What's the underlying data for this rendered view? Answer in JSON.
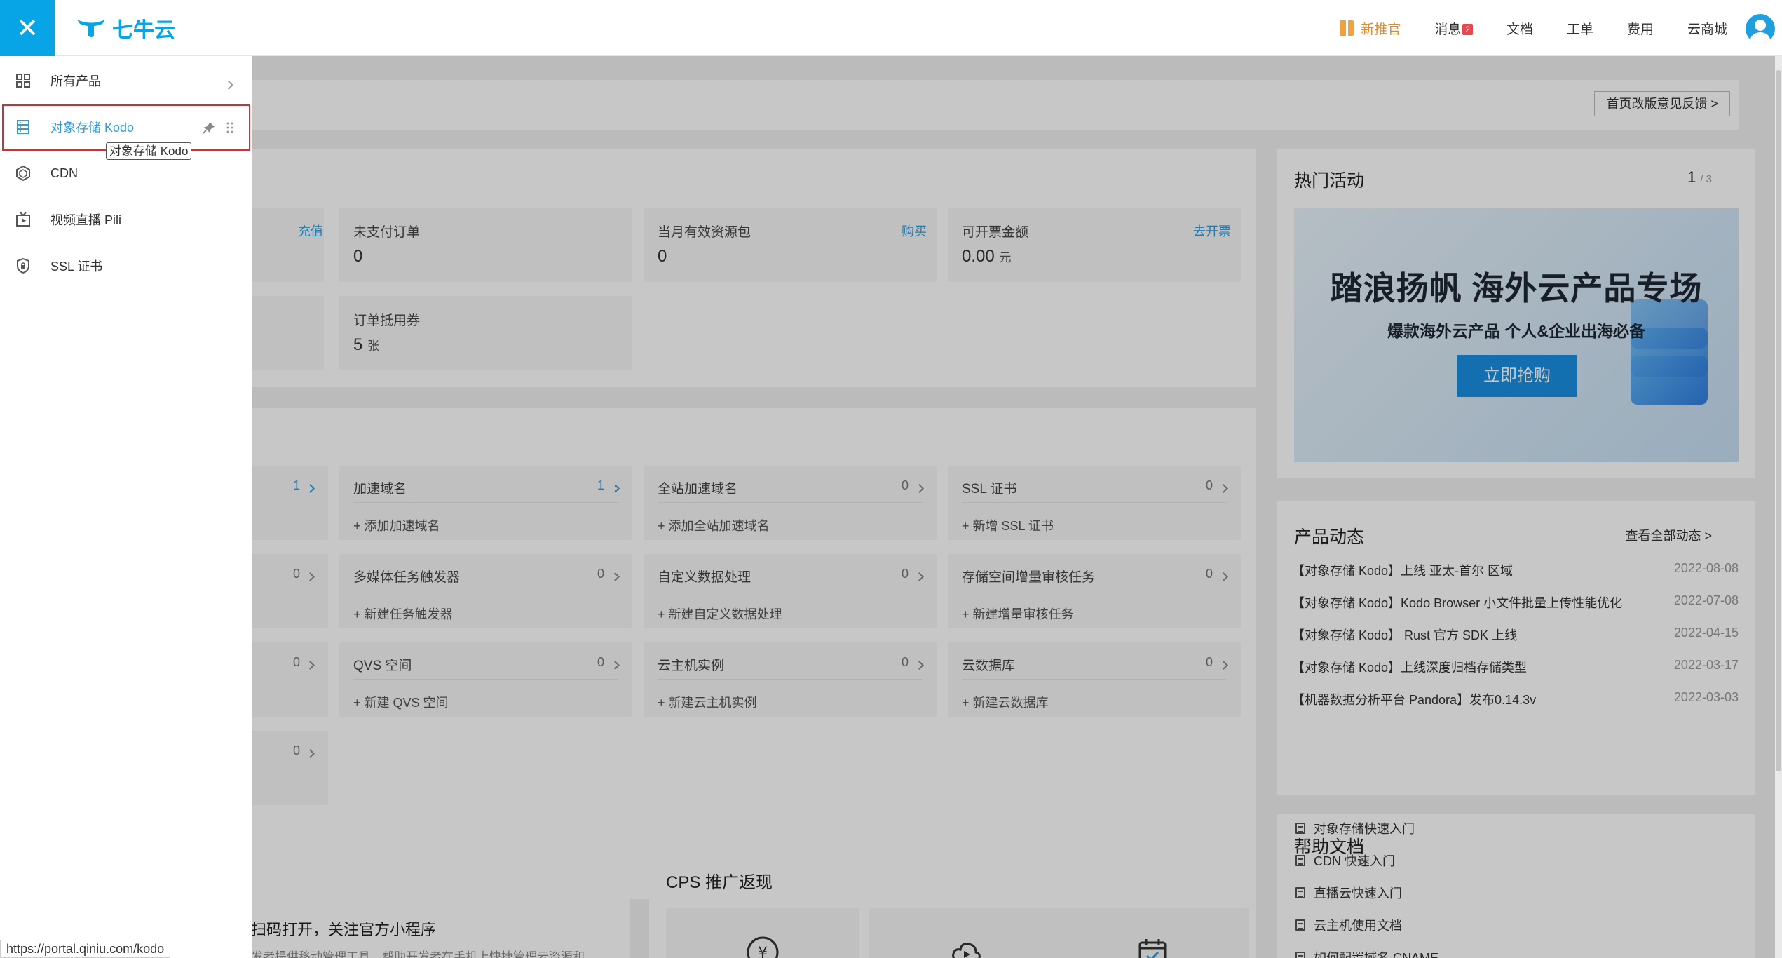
{
  "topbar": {
    "logo_text": "七牛云",
    "nav": {
      "newbie": "新推官",
      "messages": "消息",
      "messages_badge": "2",
      "docs": "文档",
      "tickets": "工单",
      "billing": "费用",
      "marketplace": "云商城"
    }
  },
  "sidebar": {
    "items": [
      {
        "label": "所有产品",
        "icon": "grid-icon"
      },
      {
        "label": "对象存储 Kodo",
        "icon": "storage-icon"
      },
      {
        "label": "CDN",
        "icon": "cdn-hexagon-icon"
      },
      {
        "label": "视频直播 Pili",
        "icon": "live-video-icon"
      },
      {
        "label": "SSL 证书",
        "icon": "shield-icon"
      }
    ],
    "tooltip": "对象存储 Kodo"
  },
  "feedback_button": "首页改版意见反馈 >",
  "overview": {
    "recharge": "充值",
    "unpaid_orders": {
      "label": "未支付订单",
      "value": "0"
    },
    "resource_packs": {
      "label": "当月有效资源包",
      "value": "0",
      "action": "购买"
    },
    "invoice": {
      "label": "可开票金额",
      "value": "0.00",
      "unit": "元",
      "action": "去开票"
    },
    "coupons": {
      "label": "订单抵用券",
      "value": "5",
      "unit": "张"
    }
  },
  "resources": {
    "left_counts": [
      "1",
      "0",
      "0",
      "0"
    ],
    "items": [
      {
        "name": "加速域名",
        "count": "1",
        "add": "添加加速域名"
      },
      {
        "name": "全站加速域名",
        "count": "0",
        "add": "添加全站加速域名"
      },
      {
        "name": "SSL 证书",
        "count": "0",
        "add": "新增 SSL 证书"
      },
      {
        "name": "多媒体任务触发器",
        "count": "0",
        "add": "新建任务触发器"
      },
      {
        "name": "自定义数据处理",
        "count": "0",
        "add": "新建自定义数据处理"
      },
      {
        "name": "存储空间增量审核任务",
        "count": "0",
        "add": "新建增量审核任务"
      },
      {
        "name": "QVS 空间",
        "count": "0",
        "add": "新建 QVS 空间"
      },
      {
        "name": "云主机实例",
        "count": "0",
        "add": "新建云主机实例"
      },
      {
        "name": "云数据库",
        "count": "0",
        "add": "新建云数据库"
      }
    ]
  },
  "mini_program": {
    "title": "扫码打开，关注官方小程序",
    "desc": "发者提供移动管理工具，帮助开发者在手机上快捷管理云资源和"
  },
  "cps": {
    "title": "CPS 推广返现"
  },
  "hot_activities": {
    "title": "热门活动",
    "page": "1",
    "total": "/ 3",
    "banner_title": "踏浪扬帆  海外云产品专场",
    "banner_sub": "爆款海外云产品 个人&企业出海必备",
    "banner_button": "立即抢购"
  },
  "product_news": {
    "title": "产品动态",
    "view_all": "查看全部动态 >",
    "items": [
      {
        "text": "【对象存储 Kodo】上线 亚太-首尔 区域",
        "date": "2022-08-08"
      },
      {
        "text": "【对象存储 Kodo】Kodo Browser 小文件批量上传性能优化",
        "date": "2022-07-08"
      },
      {
        "text": "【对象存储 Kodo】 Rust 官方 SDK 上线",
        "date": "2022-04-15"
      },
      {
        "text": "【对象存储 Kodo】上线深度归档存储类型",
        "date": "2022-03-17"
      },
      {
        "text": "【机器数据分析平台 Pandora】发布0.14.3v",
        "date": "2022-03-03"
      }
    ]
  },
  "help_docs": {
    "title": "帮助文档",
    "items": [
      "对象存储快速入门",
      "CDN 快速入门",
      "直播云快速入门",
      "云主机使用文档",
      "如何配置域名 CNAME"
    ]
  },
  "statusbar": {
    "url": "https://portal.qiniu.com/kodo"
  },
  "colors": {
    "accent": "#08a5e6",
    "link": "#2a9de0",
    "highlight_border": "#e0282e",
    "newbie": "#e08a2d"
  }
}
